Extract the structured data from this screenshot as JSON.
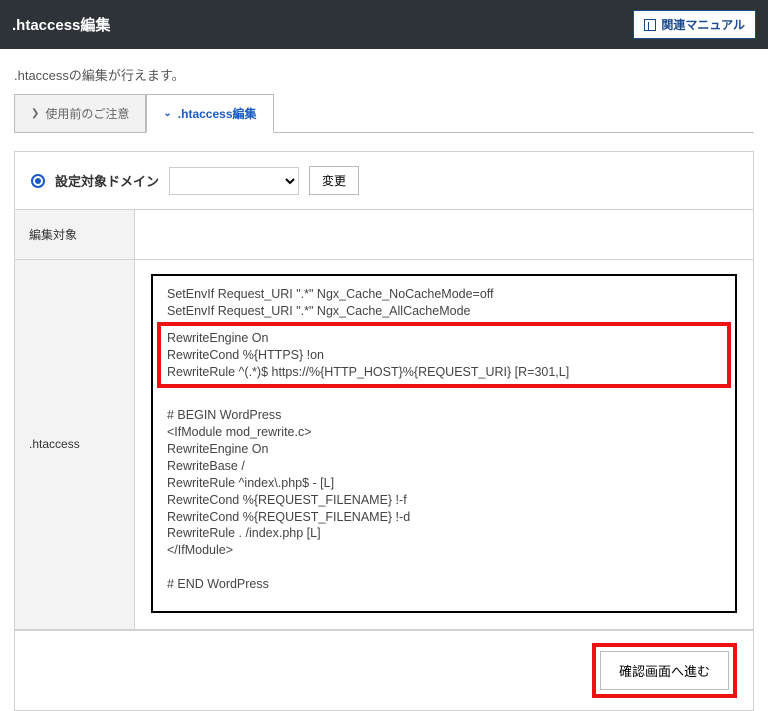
{
  "header": {
    "title": ".htaccess編集",
    "manual_label": "関連マニュアル"
  },
  "description": ".htaccessの編集が行えます。",
  "tabs": {
    "notice": "使用前のご注意",
    "edit": ".htaccess編集"
  },
  "domain": {
    "label": "設定対象ドメイン",
    "selected": "",
    "change_label": "変更"
  },
  "target": {
    "label": "編集対象",
    "value": ""
  },
  "editor": {
    "label": ".htaccess",
    "block_top": "SetEnvIf Request_URI \".*\" Ngx_Cache_NoCacheMode=off\nSetEnvIf Request_URI \".*\" Ngx_Cache_AllCacheMode",
    "block_highlight": "RewriteEngine On\nRewriteCond %{HTTPS} !on\nRewriteRule ^(.*)$ https://%{HTTP_HOST}%{REQUEST_URI} [R=301,L]",
    "block_bottom": "# BEGIN WordPress\n<IfModule mod_rewrite.c>\nRewriteEngine On\nRewriteBase /\nRewriteRule ^index\\.php$ - [L]\nRewriteCond %{REQUEST_FILENAME} !-f\nRewriteCond %{REQUEST_FILENAME} !-d\nRewriteRule . /index.php [L]\n</IfModule>\n\n# END WordPress"
  },
  "footer": {
    "confirm_label": "確認画面へ進む"
  }
}
